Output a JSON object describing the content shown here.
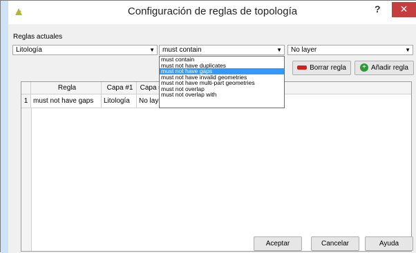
{
  "window": {
    "title": "Configuración de reglas de topología",
    "help": "?",
    "close": "✕"
  },
  "reglas_label": "Reglas actuales",
  "layer1": {
    "value": "Litología"
  },
  "rule": {
    "value": "must contain",
    "options": [
      "must contain",
      "must not have duplicates",
      "must not have gaps",
      "must not have invalid geometries",
      "must not have multi-part geometries",
      "must not overlap",
      "must not overlap with"
    ],
    "selected": "must not have gaps"
  },
  "layer2": {
    "value": "No layer"
  },
  "buttons": {
    "delete": "Borrar regla",
    "add": "Añadir regla",
    "ok": "Aceptar",
    "cancel": "Cancelar",
    "help": "Ayuda"
  },
  "table": {
    "headers": [
      "Regla",
      "Capa #1",
      "Capa #2"
    ],
    "rows": [
      {
        "num": "1",
        "regla": "must not have gaps",
        "capa1": "Litología",
        "capa2": "No layer"
      }
    ]
  },
  "colors": {
    "delete_icon": "#d02020",
    "add_icon": "#2e9a35",
    "selection": "#3399ff",
    "close_bg": "#c63d3d"
  }
}
